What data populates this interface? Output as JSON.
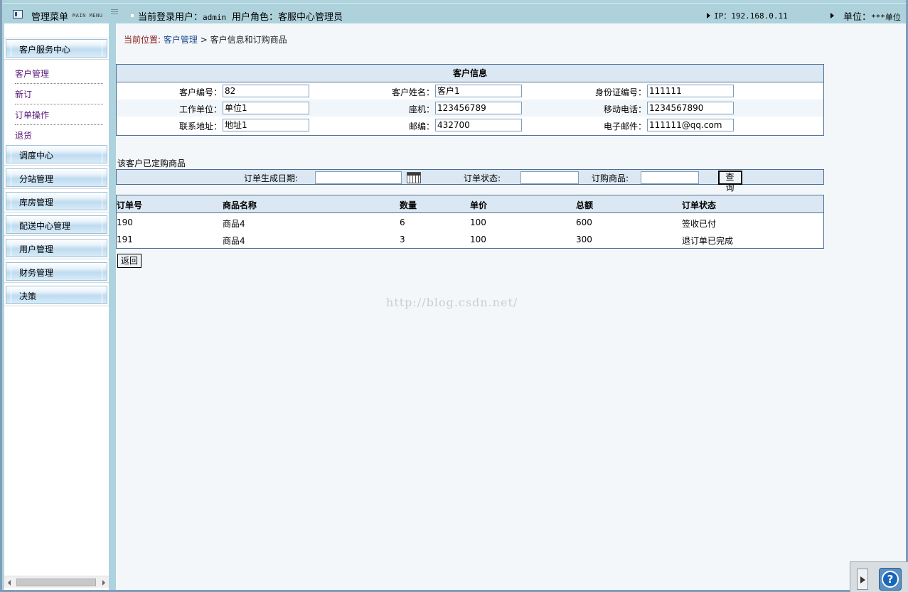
{
  "topbar": {
    "menu_title": "管理菜单",
    "menu_sub": "MAIN MENU",
    "user_label": "当前登录用户：",
    "user_name": "admin",
    "role_label": "用户角色：客服中心管理员",
    "ip_label": "IP：192.168.0.11",
    "unit_label": "单位：",
    "unit_value": "***单位"
  },
  "sidebar": {
    "groups": [
      "客户服务中心",
      "调度中心",
      "分站管理",
      "库房管理",
      "配送中心管理",
      "用户管理",
      "财务管理",
      "决策"
    ],
    "items": [
      "客户管理",
      "新订",
      "订单操作",
      "退货"
    ]
  },
  "breadcrumb": {
    "prefix": "当前位置:",
    "link": "客户管理",
    "rest": " > 客户信息和订购商品"
  },
  "customer_info": {
    "title": "客户信息",
    "fields": {
      "customer_id_label": "客户编号：",
      "customer_id": "82",
      "customer_name_label": "客户姓名：",
      "customer_name": "客户1",
      "id_card_label": "身份证编号：",
      "id_card": "111111",
      "work_unit_label": "工作单位：",
      "work_unit": "单位1",
      "landline_label": "座机：",
      "landline": "123456789",
      "mobile_label": "移动电话：",
      "mobile": "1234567890",
      "address_label": "联系地址：",
      "address": "地址1",
      "postcode_label": "邮编：",
      "postcode": "432700",
      "email_label": "电子邮件：",
      "email": "111111@qq.com"
    }
  },
  "orders": {
    "section_title": "该客户已定购商品",
    "search": {
      "date_label": "订单生成日期:",
      "status_label": "订单状态:",
      "product_label": "订购商品:",
      "query_button": "查询"
    },
    "columns": [
      "订单号",
      "商品名称",
      "数量",
      "单价",
      "总额",
      "订单状态"
    ],
    "rows": [
      [
        "190",
        "商品4",
        "6",
        "100",
        "600",
        "签收已付"
      ],
      [
        "191",
        "商品4",
        "3",
        "100",
        "300",
        "退订单已完成"
      ]
    ],
    "back_button": "返回"
  },
  "watermark": "http://blog.csdn.net/"
}
